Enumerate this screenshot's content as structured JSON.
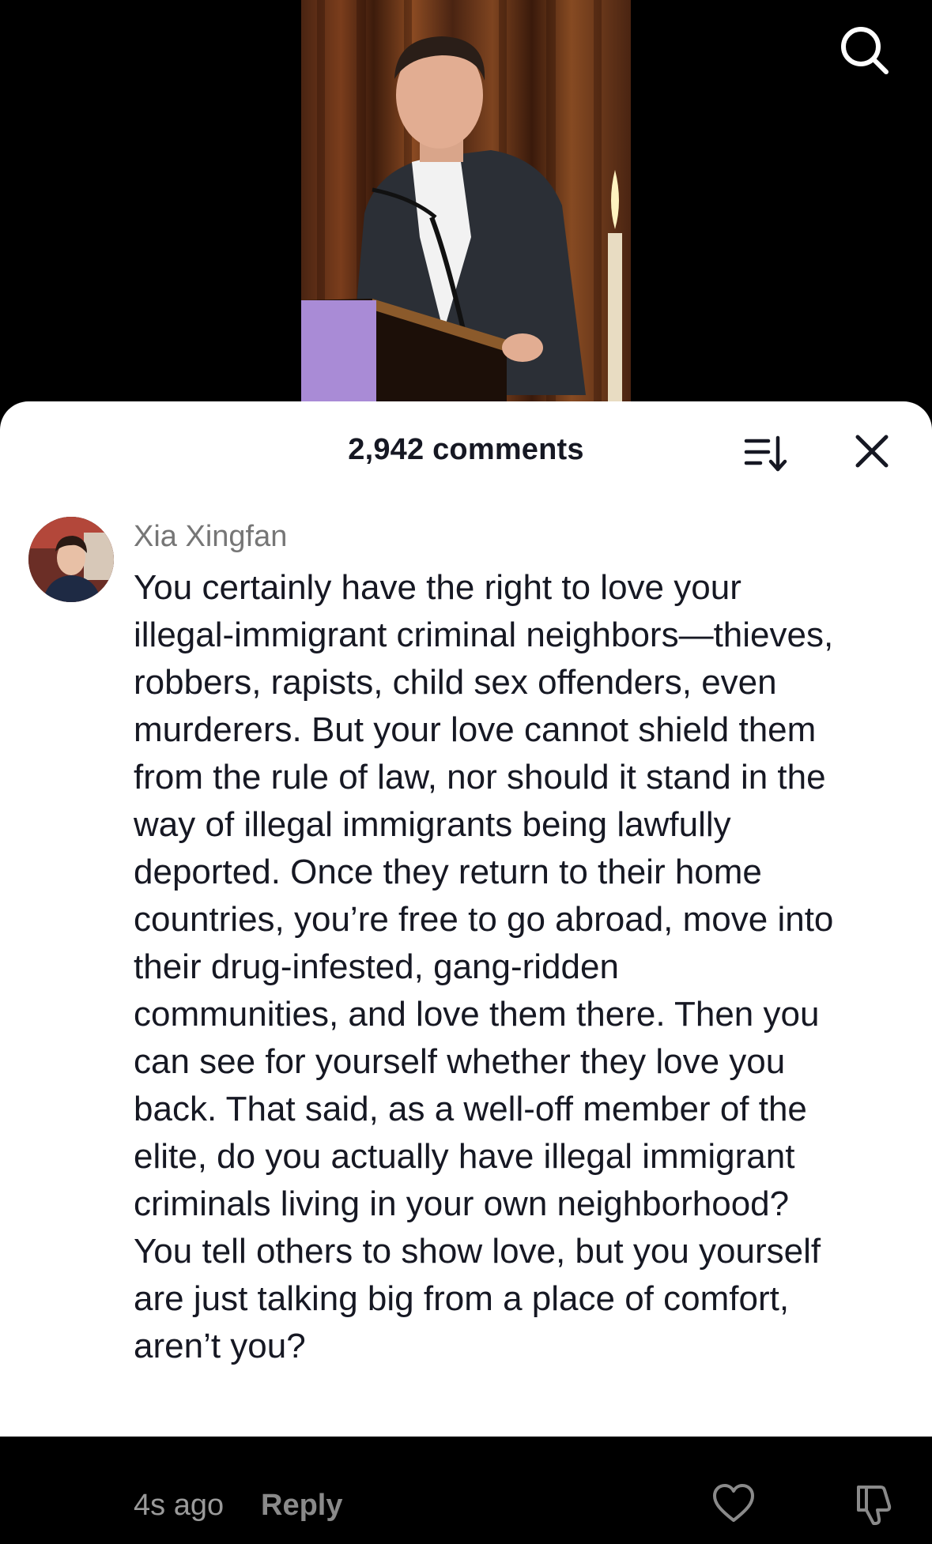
{
  "video": {
    "background_color": "#000000",
    "icons": {
      "search": "search-icon"
    }
  },
  "comments_sheet": {
    "header": {
      "comment_count_label": "2,942 comments",
      "icons": {
        "sort": "sort-list-icon",
        "close": "close-icon"
      }
    },
    "comment": {
      "username": "Xia Xingfan",
      "text": "You certainly have the right to love your\nillegal-immigrant criminal neighbors—thieves,\nrobbers, rapists, child sex offenders, even\nmurderers. But your love cannot shield them\nfrom the rule of law, nor should it stand in the\nway of illegal immigrants being lawfully\ndeported. Once they return to their home\ncountries, you’re free to go abroad, move into\ntheir drug-infested, gang-ridden\ncommunities, and love them there. Then you\ncan see for yourself whether they love you\nback. That said, as a well-off member of the\nelite, do you actually have illegal immigrant\ncriminals living in your own neighborhood?\nYou tell others to show love, but you yourself\nare just talking big from a place of comfort,\naren’t you?",
      "timestamp": "4s ago",
      "reply_label": "Reply",
      "icons": {
        "avatar": "avatar",
        "like": "heart-icon",
        "dislike": "thumbs-down-icon"
      }
    }
  },
  "colors": {
    "sheet_background": "#ffffff",
    "primary_text": "#161823",
    "secondary_text": "#767676",
    "muted_text": "#9a9a9a"
  }
}
